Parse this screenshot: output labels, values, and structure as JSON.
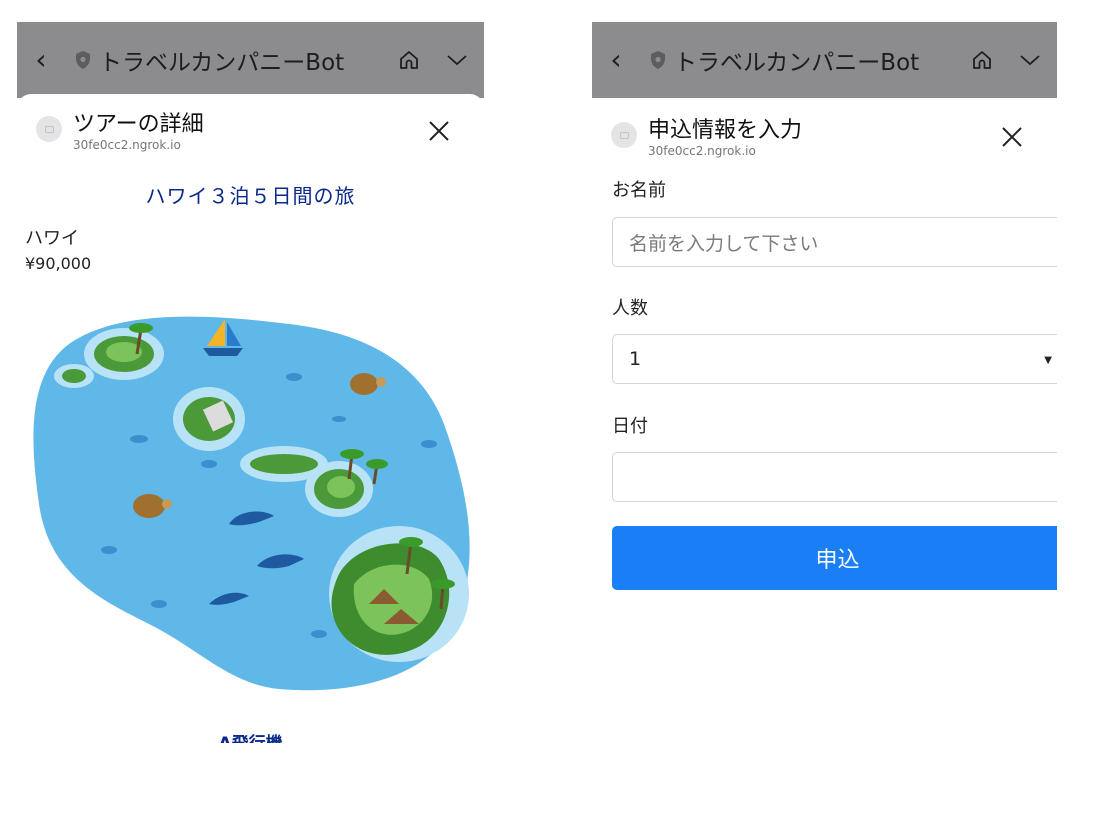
{
  "left_screen": {
    "topbar": {
      "back_icon": "chevron-left",
      "title": "トラベルカンパニーBot",
      "home_icon": "home",
      "menu_icon": "chevron-down"
    },
    "sheet": {
      "title": "ツアーの詳細",
      "domain": "30fe0cc2.ngrok.io",
      "close_icon": "close"
    },
    "tour": {
      "title": "ハワイ３泊５日間の旅",
      "destination": "ハワイ",
      "price": "¥90,000",
      "image_icon": "hawaii-map-illustration",
      "bottom_label": "A飛行機"
    }
  },
  "right_screen": {
    "topbar": {
      "back_icon": "chevron-left",
      "title": "トラベルカンパニーBot",
      "home_icon": "home",
      "menu_icon": "chevron-down"
    },
    "sheet": {
      "title": "申込情報を入力",
      "domain": "30fe0cc2.ngrok.io",
      "close_icon": "close"
    },
    "form": {
      "name_label": "お名前",
      "name_placeholder": "名前を入力して下さい",
      "name_value": "",
      "count_label": "人数",
      "count_value": "1",
      "date_label": "日付",
      "date_value": "",
      "submit_label": "申込"
    }
  },
  "colors": {
    "topbar": "#8c8c8e",
    "tour_title": "#0a2a8a",
    "submit_button": "#1a7ff5",
    "ocean": "#5fb8e8",
    "island": "#4a9a3a"
  }
}
